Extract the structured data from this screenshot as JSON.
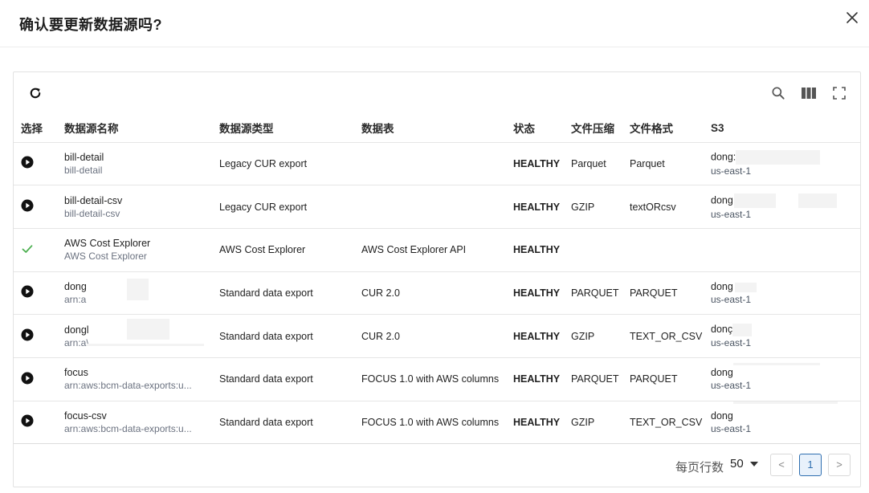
{
  "dialog": {
    "title": "确认要更新数据源吗?"
  },
  "table": {
    "columns": [
      "选择",
      "数据源名称",
      "数据源类型",
      "数据表",
      "状态",
      "文件压缩",
      "文件格式",
      "S3"
    ],
    "rows": [
      {
        "selected": false,
        "name": "bill-detail",
        "name_sub": "bill-detail",
        "type": "Legacy CUR export",
        "table": "",
        "status": "HEALTHY",
        "compression": "Parquet",
        "format": "Parquet",
        "s3_main": "dong:",
        "s3_sub": "us-east-1"
      },
      {
        "selected": false,
        "name": "bill-detail-csv",
        "name_sub": "bill-detail-csv",
        "type": "Legacy CUR export",
        "table": "",
        "status": "HEALTHY",
        "compression": "GZIP",
        "format": "textORcsv",
        "s3_main": "dong",
        "s3_sub": "us-east-1"
      },
      {
        "selected": true,
        "name": "AWS Cost Explorer",
        "name_sub": "AWS Cost Explorer",
        "type": "AWS Cost Explorer",
        "table": "AWS Cost Explorer API",
        "status": "HEALTHY",
        "compression": "",
        "format": "",
        "s3_main": "",
        "s3_sub": ""
      },
      {
        "selected": false,
        "name": "dong",
        "name_sub": "arn:a",
        "type": "Standard data export",
        "table": "CUR 2.0",
        "status": "HEALTHY",
        "compression": "PARQUET",
        "format": "PARQUET",
        "s3_main": "dong",
        "s3_sub": "us-east-1"
      },
      {
        "selected": false,
        "name": "dongl",
        "name_sub": "arn:a\\",
        "type": "Standard data export",
        "table": "CUR 2.0",
        "status": "HEALTHY",
        "compression": "GZIP",
        "format": "TEXT_OR_CSV",
        "s3_main": "donç",
        "s3_sub": "us-east-1"
      },
      {
        "selected": false,
        "name": "focus",
        "name_sub": "arn:aws:bcm-data-exports:u...",
        "type": "Standard data export",
        "table": "FOCUS 1.0 with AWS columns",
        "status": "HEALTHY",
        "compression": "PARQUET",
        "format": "PARQUET",
        "s3_main": "dong",
        "s3_sub": "us-east-1"
      },
      {
        "selected": false,
        "name": "focus-csv",
        "name_sub": "arn:aws:bcm-data-exports:u...",
        "type": "Standard data export",
        "table": "FOCUS 1.0 with AWS columns",
        "status": "HEALTHY",
        "compression": "GZIP",
        "format": "TEXT_OR_CSV",
        "s3_main": "dong",
        "s3_sub": "us-east-1"
      }
    ]
  },
  "pagination": {
    "rows_per_page_label": "每页行数",
    "rows_per_page_value": "50",
    "current_page": "1",
    "prev_symbol": "<",
    "next_symbol": ">"
  },
  "icons": {
    "refresh": "refresh-icon",
    "search": "search-icon",
    "columns": "columns-icon",
    "fullscreen": "fullscreen-icon",
    "close": "close-icon"
  },
  "colors": {
    "status_healthy": "#2e7d32",
    "selected_check": "#4caf50",
    "page_active": "#2f6fb0"
  }
}
